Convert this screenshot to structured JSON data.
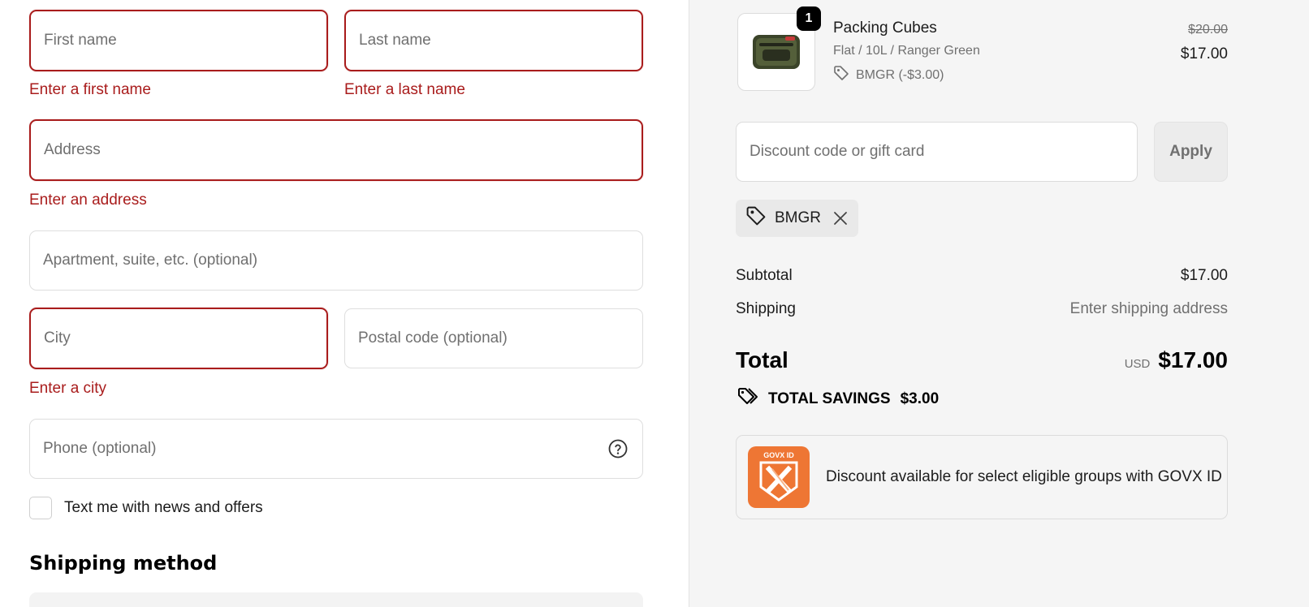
{
  "form": {
    "first_name": {
      "placeholder": "First name",
      "error": "Enter a first name"
    },
    "last_name": {
      "placeholder": "Last name",
      "error": "Enter a last name"
    },
    "address": {
      "placeholder": "Address",
      "error": "Enter an address"
    },
    "apartment": {
      "placeholder": "Apartment, suite, etc. (optional)"
    },
    "city": {
      "placeholder": "City",
      "error": "Enter a city"
    },
    "postal_code": {
      "placeholder": "Postal code (optional)"
    },
    "phone": {
      "placeholder": "Phone (optional)"
    },
    "news_checkbox_label": "Text me with news and offers",
    "shipping_method_title": "Shipping method"
  },
  "order": {
    "item": {
      "quantity": "1",
      "name": "Packing Cubes",
      "variant": "Flat / 10L / Ranger Green",
      "discount": "BMGR (-$3.00)",
      "original_price": "$20.00",
      "price": "$17.00"
    },
    "discount_field": {
      "placeholder": "Discount code or gift card"
    },
    "apply_label": "Apply",
    "applied_code": "BMGR",
    "subtotal_label": "Subtotal",
    "subtotal_value": "$17.00",
    "shipping_label": "Shipping",
    "shipping_value": "Enter shipping address",
    "total_label": "Total",
    "currency": "USD",
    "total_value": "$17.00",
    "savings_label": "TOTAL SAVINGS",
    "savings_value": "$3.00",
    "govx_logo_text": "GOVX ID",
    "govx_text": "Discount available for select eligible groups with GOVX ID"
  },
  "colors": {
    "error": "#a91c1c",
    "sidebar_bg": "#f5f5f5",
    "govx_orange": "#ee7634"
  },
  "icons": [
    "help-icon",
    "tag-icon",
    "close-icon",
    "tags-icon",
    "govx-logo"
  ]
}
